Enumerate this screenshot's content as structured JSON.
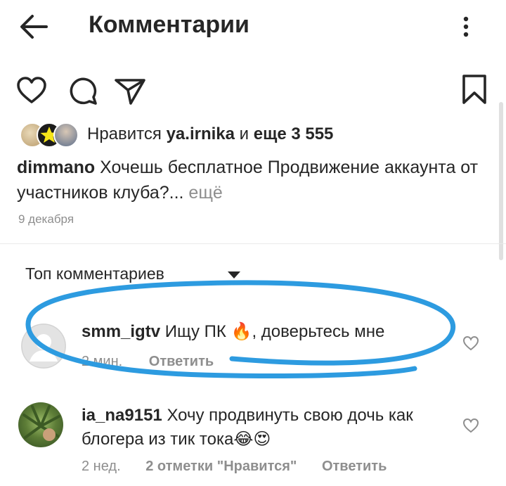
{
  "header": {
    "title": "Комментарии",
    "back_icon": "arrow-left-icon",
    "menu_icon": "more-vertical-icon"
  },
  "actions": {
    "icons": [
      "heart-icon",
      "comment-icon",
      "send-icon",
      "bookmark-icon"
    ]
  },
  "likes": {
    "prefix": "Нравится",
    "user": "ya.irnika",
    "conjunction": "и",
    "others": "еще 3 555"
  },
  "caption": {
    "user": "dimmano",
    "text": "Хочешь бесплатное Продвижение аккаунта от участников клуба?...",
    "more": " ещё"
  },
  "post_date": "9 декабря",
  "sort": {
    "label": "Топ комментариев",
    "icon": "caret-down-icon"
  },
  "comments": [
    {
      "user": "smm_igtv",
      "text_before": "Ищу ПК",
      "emoji1": "🔥",
      "text_after": ", доверьтесь мне",
      "time": "2 мин.",
      "reply": "Ответить"
    },
    {
      "user": "ia_na9151",
      "text_before": "Хочу продвинуть свою дочь как блогера из тик тока",
      "emoji1": "😂",
      "emoji2": "😍",
      "time": "2 нед.",
      "likes": "2 отметки \"Нравится\"",
      "reply": "Ответить"
    }
  ],
  "annotation_color": "#2d9be0"
}
